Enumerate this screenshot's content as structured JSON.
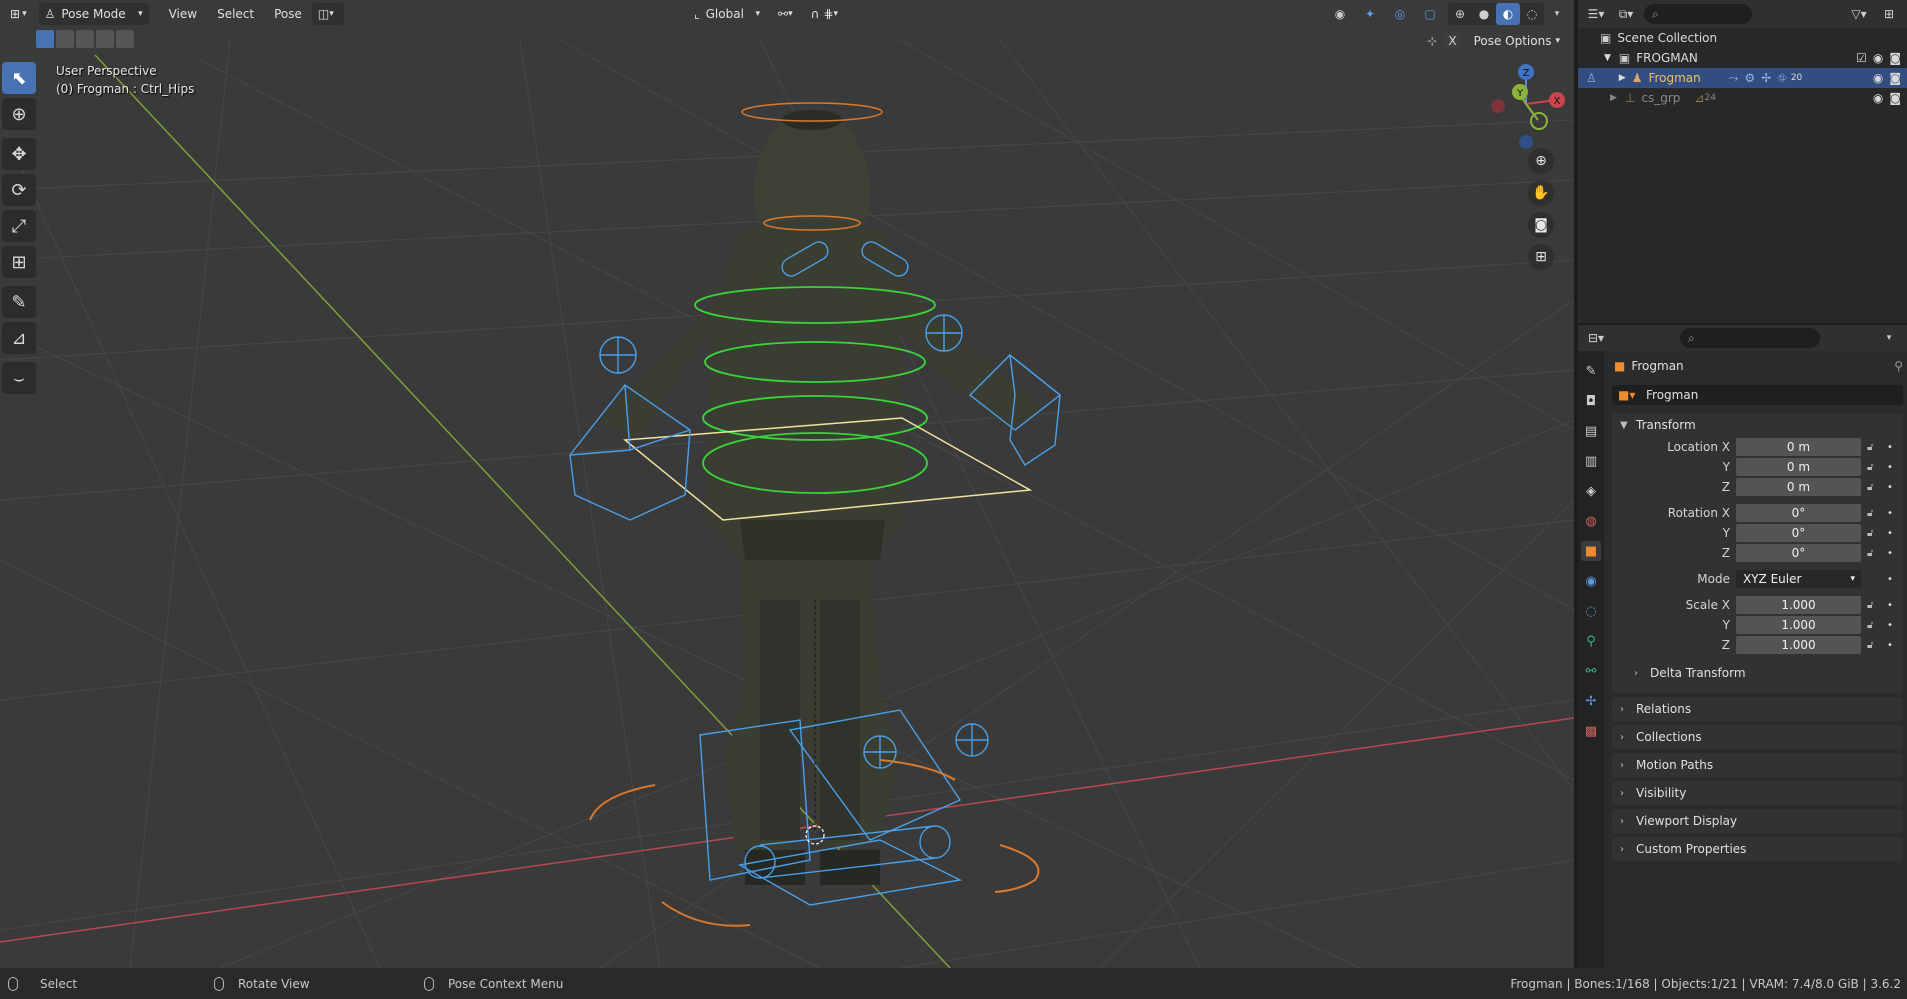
{
  "header": {
    "mode_label": "Pose Mode",
    "menus": [
      "View",
      "Select",
      "Pose"
    ],
    "transform_orientation": "Global",
    "pose_options_label": "Pose Options",
    "pose_options_x": "X"
  },
  "viewport": {
    "perspective_label": "User Perspective",
    "active_label": "(0) Frogman : Ctrl_Hips"
  },
  "gizmo": {
    "z": "Z",
    "y": "Y",
    "x": "X"
  },
  "outliner": {
    "scene_collection": "Scene Collection",
    "collection": "FROGMAN",
    "object": "Frogman",
    "child": "cs_grp",
    "child_count": "24",
    "object_badge": "20"
  },
  "properties": {
    "object_name": "Frogman",
    "name_field": "Frogman",
    "transform_title": "Transform",
    "location_label": "Location X",
    "loc_x": "0 m",
    "loc_y": "0 m",
    "loc_z": "0 m",
    "rotation_label": "Rotation X",
    "rot_x": "0°",
    "rot_y": "0°",
    "rot_z": "0°",
    "mode_label": "Mode",
    "mode_value": "XYZ Euler",
    "scale_label": "Scale X",
    "scale_x": "1.000",
    "scale_y": "1.000",
    "scale_z": "1.000",
    "y_label": "Y",
    "z_label": "Z",
    "delta_transform": "Delta Transform",
    "panels": [
      "Relations",
      "Collections",
      "Motion Paths",
      "Visibility",
      "Viewport Display",
      "Custom Properties"
    ]
  },
  "statusbar": {
    "select": "Select",
    "rotate_view": "Rotate View",
    "context_menu": "Pose Context Menu",
    "stats": "Frogman | Bones:1/168 | Objects:1/21 | VRAM: 7.4/8.0 GiB | 3.6.2"
  },
  "colors": {
    "accent": "#4772b3",
    "bone_blue": "#4a9fe8",
    "bone_green": "#3bd33b",
    "bone_orange": "#d9792e",
    "active_yellow": "#f0e2a0",
    "x_axis": "#b8474e",
    "y_axis": "#7aa03a"
  }
}
